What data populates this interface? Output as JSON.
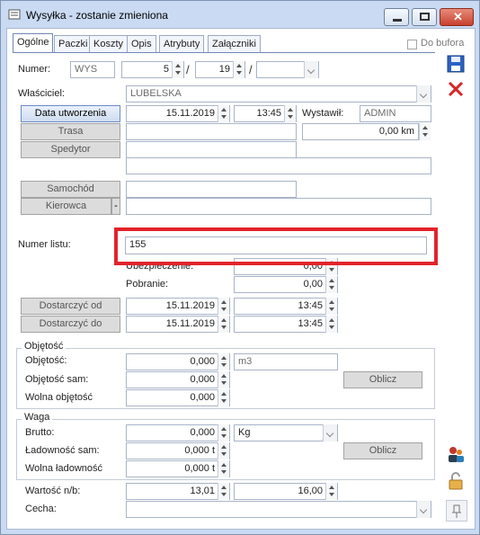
{
  "window": {
    "title": "Wysyłka - zostanie zmieniona",
    "controls": {
      "minimize": "minimize-icon",
      "maximize": "maximize-icon",
      "close": "close-icon"
    },
    "accent_color": "#c9daf2"
  },
  "tabs": [
    {
      "label": "Ogólne",
      "active": true
    },
    {
      "label": "Paczki"
    },
    {
      "label": "Koszty"
    },
    {
      "label": "Opis"
    },
    {
      "label": "Atrybuty"
    },
    {
      "label": "Załączniki"
    }
  ],
  "do_bufora": {
    "label": "Do bufora",
    "checked": false
  },
  "numer": {
    "label": "Numer:",
    "prefix": "WYS",
    "num": "5",
    "sep1": "/",
    "year": "19",
    "sep2": "/",
    "series": ""
  },
  "wlasciciel": {
    "label": "Właściciel:",
    "value": "LUBELSKA"
  },
  "data_utworzenia": {
    "button": "Data utworzenia",
    "date": "15.11.2019",
    "time": "13:45"
  },
  "wystawil": {
    "label": "Wystawił:",
    "value": "ADMIN"
  },
  "trasa": {
    "button": "Trasa",
    "value": "",
    "km": "0,00 km"
  },
  "spedytor": {
    "button": "Spedytor",
    "value": "",
    "value2": ""
  },
  "samochod": {
    "button": "Samochód",
    "value": ""
  },
  "kierowca": {
    "button": "Kierowca",
    "dash": "-",
    "value": ""
  },
  "numer_listu": {
    "label": "Numer listu:",
    "value": "155"
  },
  "ubezpieczenie": {
    "label": "Ubezpieczenie:",
    "value": "0,00"
  },
  "pobranie": {
    "label": "Pobranie:",
    "value": "0,00"
  },
  "dostarczyc_od": {
    "button": "Dostarczyć od",
    "date": "15.11.2019",
    "time": "13:45"
  },
  "dostarczyc_do": {
    "button": "Dostarczyć do",
    "date": "15.11.2019",
    "time": "13:45"
  },
  "objetosc_group": {
    "title": "Objętość",
    "objetosc": {
      "label": "Objętość:",
      "value": "0,000",
      "unit": "m3"
    },
    "objetosc_sam": {
      "label": "Objętość sam:",
      "value": "0,000"
    },
    "wolna_objetosc": {
      "label": "Wolna objętość",
      "value": "0,000"
    },
    "oblicz": "Oblicz"
  },
  "waga_group": {
    "title": "Waga",
    "brutto": {
      "label": "Brutto:",
      "value": "0,000",
      "unit": "Kg"
    },
    "ladownosc_sam": {
      "label": "Ładowność sam:",
      "value": "0,000 t"
    },
    "wolna_ladownosc": {
      "label": "Wolna ładowność",
      "value": "0,000 t"
    },
    "oblicz": "Oblicz"
  },
  "wartosc": {
    "label": "Wartość n/b:",
    "netto": "13,01",
    "brutto": "16,00"
  },
  "cecha": {
    "label": "Cecha:",
    "value": ""
  },
  "side_icons": [
    "save-icon",
    "delete-icon",
    "users-icon",
    "lock-icon",
    "pin-icon"
  ],
  "highlight_color": "#e3232b"
}
